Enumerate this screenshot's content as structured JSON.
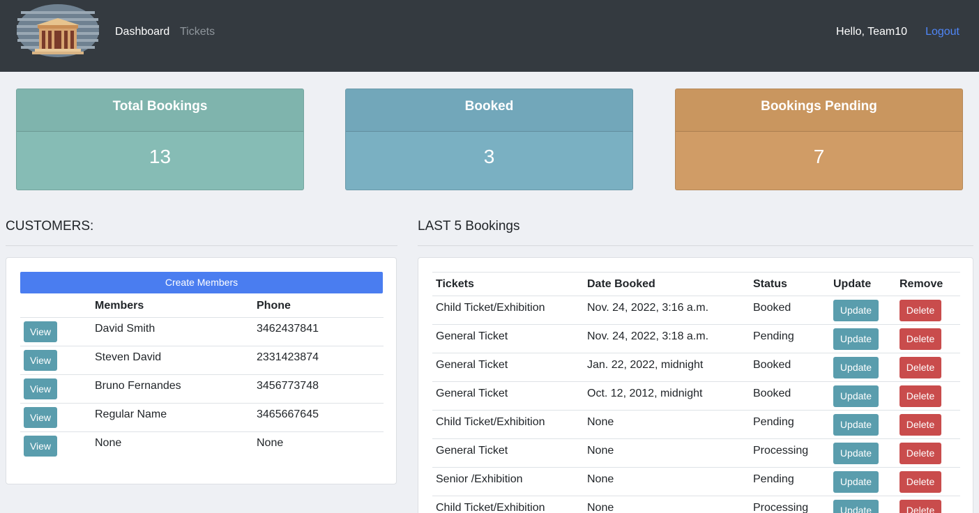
{
  "navbar": {
    "links": {
      "dashboard": "Dashboard",
      "tickets": "Tickets"
    },
    "greeting": "Hello, Team10",
    "logout": "Logout"
  },
  "stats": {
    "total": {
      "label": "Total Bookings",
      "value": "13"
    },
    "booked": {
      "label": "Booked",
      "value": "3"
    },
    "pending": {
      "label": "Bookings Pending",
      "value": "7"
    }
  },
  "customers": {
    "title": "CUSTOMERS:",
    "create_label": "Create Members",
    "headers": {
      "members": "Members",
      "phone": "Phone"
    },
    "view_label": "View",
    "rows": [
      {
        "name": "David Smith",
        "phone": "3462437841"
      },
      {
        "name": "Steven David",
        "phone": "2331423874"
      },
      {
        "name": "Bruno Fernandes",
        "phone": "3456773748"
      },
      {
        "name": "Regular Name",
        "phone": "3465667645"
      },
      {
        "name": "None",
        "phone": "None"
      }
    ]
  },
  "bookings": {
    "title": "LAST 5 Bookings",
    "headers": {
      "tickets": "Tickets",
      "date": "Date Booked",
      "status": "Status",
      "update": "Update",
      "remove": "Remove"
    },
    "update_label": "Update",
    "delete_label": "Delete",
    "rows": [
      {
        "ticket": "Child Ticket/Exhibition",
        "date": "Nov. 24, 2022, 3:16 a.m.",
        "status": "Booked"
      },
      {
        "ticket": "General Ticket",
        "date": "Nov. 24, 2022, 3:18 a.m.",
        "status": "Pending"
      },
      {
        "ticket": "General Ticket",
        "date": "Jan. 22, 2022, midnight",
        "status": "Booked"
      },
      {
        "ticket": "General Ticket",
        "date": "Oct. 12, 2012, midnight",
        "status": "Booked"
      },
      {
        "ticket": "Child Ticket/Exhibition",
        "date": "None",
        "status": "Pending"
      },
      {
        "ticket": "General Ticket",
        "date": "None",
        "status": "Processing"
      },
      {
        "ticket": "Senior /Exhibition",
        "date": "None",
        "status": "Pending"
      },
      {
        "ticket": "Child Ticket/Exhibition",
        "date": "None",
        "status": "Processing"
      }
    ]
  },
  "colors": {
    "navbar": "#343a40",
    "primary": "#4a7df0",
    "info": "#5a9dad",
    "danger": "#c94c4c",
    "card_total": "#86bcb5",
    "card_booked": "#7ab0c2",
    "card_pending": "#d09c66"
  },
  "icons": {
    "logo": "museum-logo-icon"
  }
}
